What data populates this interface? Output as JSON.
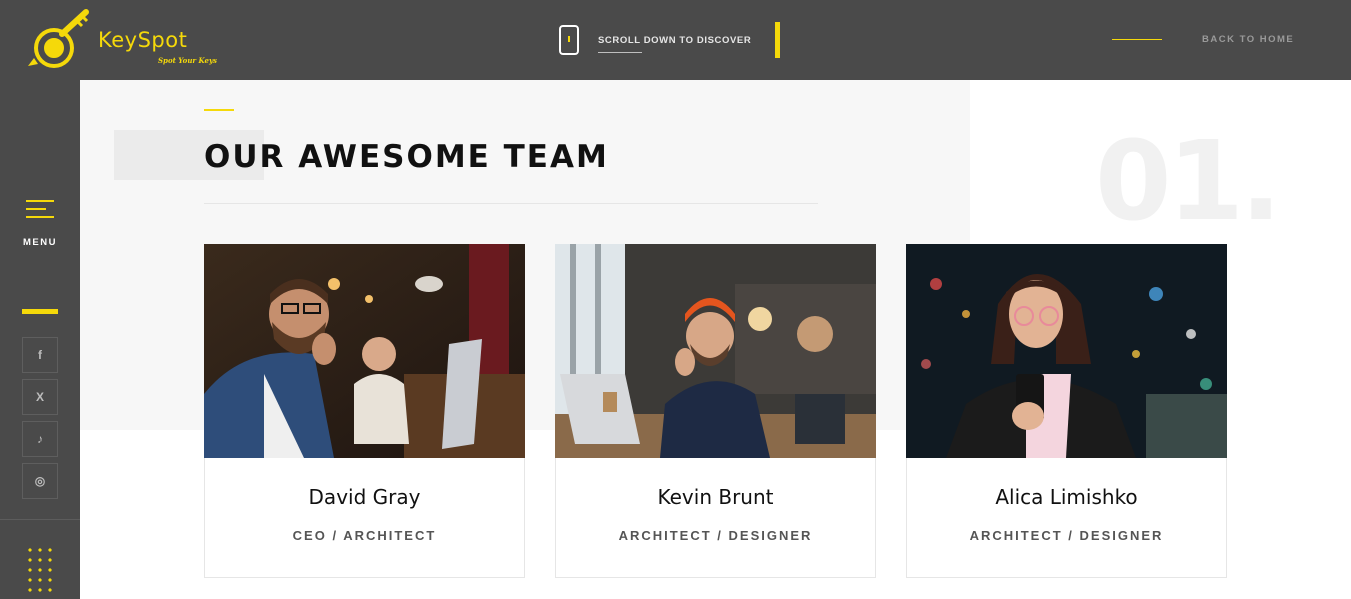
{
  "header": {
    "logo_name": "KeySpot",
    "logo_tagline": "Spot Your Keys",
    "scroll_label": "SCROLL DOWN TO DISCOVER",
    "back_home_label": "BACK TO HOME"
  },
  "sidebar": {
    "menu_label": "MENU",
    "social": [
      {
        "icon": "facebook-icon",
        "glyph": "f"
      },
      {
        "icon": "x-icon",
        "glyph": "X"
      },
      {
        "icon": "tiktok-icon",
        "glyph": "♪"
      },
      {
        "icon": "instagram-icon",
        "glyph": "◎"
      }
    ]
  },
  "section": {
    "title": "OUR AWESOME TEAM",
    "number": "01."
  },
  "team": [
    {
      "name": "David Gray",
      "role": "CEO / ARCHITECT"
    },
    {
      "name": "Kevin Brunt",
      "role": "ARCHITECT / DESIGNER"
    },
    {
      "name": "Alica Limishko",
      "role": "ARCHITECT / DESIGNER"
    }
  ],
  "colors": {
    "accent": "#f5d90a",
    "header_bg": "#4a4a4a",
    "section_bg": "#f7f7f7"
  }
}
